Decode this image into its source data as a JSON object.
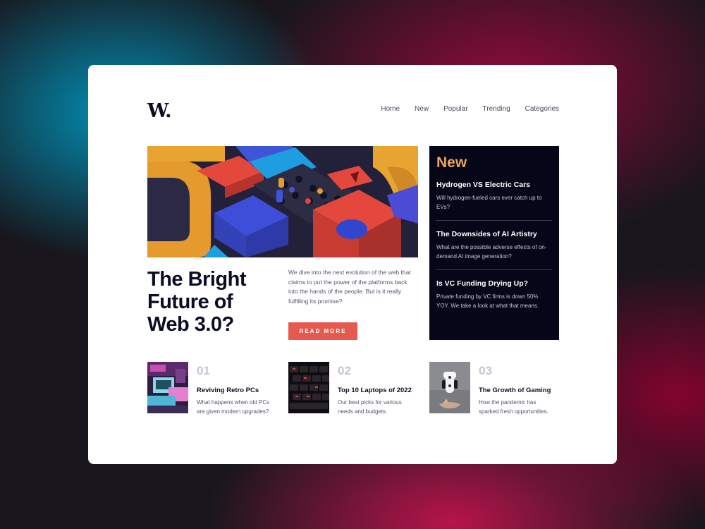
{
  "site": {
    "logo": "W."
  },
  "nav": [
    "Home",
    "New",
    "Popular",
    "Trending",
    "Categories"
  ],
  "hero": {
    "image": "colorful-3d-blocks-image",
    "headline_lines": [
      "The Bright",
      "Future of",
      "Web 3.0?"
    ],
    "lede": "We dive into the next evolution of the web that claims to put the power of the platforms back into the hands of the people. But is it really fulfilling its promise?",
    "cta": "READ MORE"
  },
  "sidebar": {
    "title": "New",
    "items": [
      {
        "title": "Hydrogen VS Electric Cars",
        "desc": "Will hydrogen-fueled cars ever catch up to EVs?"
      },
      {
        "title": "The Downsides of AI Artistry",
        "desc": "What are the possible adverse effects of on-demand AI image generation?"
      },
      {
        "title": "Is VC Funding Drying Up?",
        "desc": "Private funding by VC firms is down 50% YOY. We take a look at what that means."
      }
    ]
  },
  "articles": [
    {
      "num": "01",
      "title": "Reviving Retro PCs",
      "desc": "What happens when old PCs are given modern upgrades?",
      "image": "retro-pc-image"
    },
    {
      "num": "02",
      "title": "Top 10 Laptops of 2022",
      "desc": "Our best picks for various needs and budgets.",
      "image": "laptop-keyboard-image"
    },
    {
      "num": "03",
      "title": "The Growth of Gaming",
      "desc": "How the pandemic has sparked fresh opportunities.",
      "image": "game-controller-image"
    }
  ],
  "colors": {
    "accent": "#e5594e",
    "sidebar_bg": "#060619",
    "sidebar_title": "#e9a65b",
    "text_dark": "#0b0d24"
  }
}
